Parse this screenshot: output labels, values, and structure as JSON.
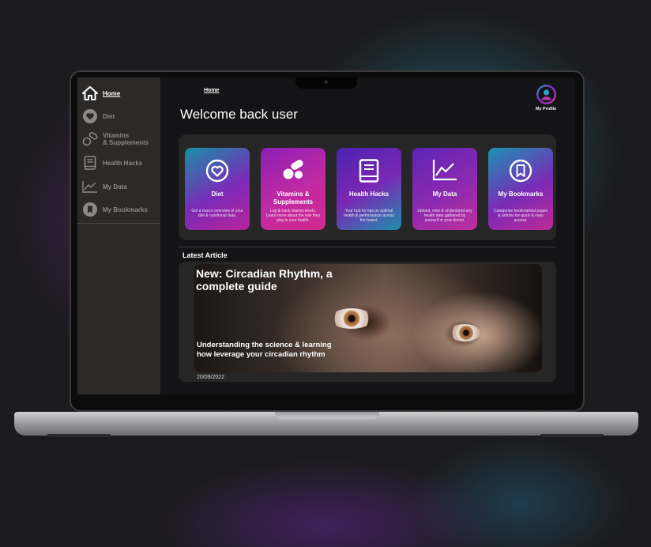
{
  "sidebar": {
    "items": [
      {
        "label": "Home",
        "icon": "home-icon"
      },
      {
        "label": "Diet",
        "icon": "heart-icon"
      },
      {
        "label": "Vitamins\n& Supplements",
        "icon": "pill-icon"
      },
      {
        "label": "Health Hacks",
        "icon": "book-icon"
      },
      {
        "label": "My Data",
        "icon": "chart-icon"
      },
      {
        "label": "My Bookmarks",
        "icon": "bookmark-icon"
      }
    ]
  },
  "header": {
    "breadcrumb": "Home",
    "title": "Welcome back user",
    "profile_label": "My Profile"
  },
  "cards": [
    {
      "name": "Diet",
      "desc": "Get a macro overview of your diet & nutritional data.",
      "icon": "heart-icon"
    },
    {
      "name": "Vitamins & Supplements",
      "desc": "Log & track vitamin levels. Learn more about the role they play in your health.",
      "icon": "pill-icon"
    },
    {
      "name": "Health Hacks",
      "desc": "Your hub for tips on optimal health & performance across the board.",
      "icon": "book-icon"
    },
    {
      "name": "My Data",
      "desc": "Upload, view & understand any health data gathered by yourself or your doctor.",
      "icon": "chart-icon"
    },
    {
      "name": "My Bookmarks",
      "desc": "Categorise bookmarked pages & articles for quick & easy access.",
      "icon": "bookmark-icon"
    }
  ],
  "latest": {
    "heading": "Latest Article",
    "title": "New: Circadian Rhythm, a complete guide",
    "subtitle": "Understanding the science & learning how leverage your circadian rhythm",
    "date": "20/09/2022"
  }
}
